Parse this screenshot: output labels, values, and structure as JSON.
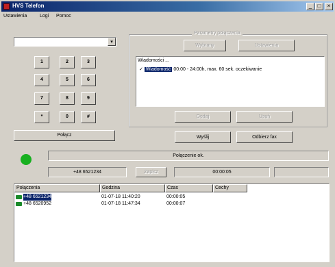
{
  "window": {
    "title": "HVS Telefon"
  },
  "menu": [
    {
      "label": "Ustawienia"
    },
    {
      "label": "Logi"
    },
    {
      "label": "Pomoc"
    }
  ],
  "dial": {
    "combo_value": "",
    "keys": [
      "1",
      "2",
      "3",
      "4",
      "5",
      "6",
      "7",
      "8",
      "9",
      "*",
      "0",
      "#"
    ],
    "connect_label": "Połącz"
  },
  "connection_group": {
    "legend": "Parametry połączenia",
    "tabs": [
      "Wybrany",
      "Ustawienia"
    ],
    "list_header": "Wiadomości ...",
    "list_item_selected": "Wiadomość",
    "list_item_detail": "00:00 - 24:00h, max. 60 sek. oczekiwanie",
    "buttons": [
      "Dodaj",
      "Usuń"
    ]
  },
  "actions": {
    "send": "Wyślij",
    "fax": "Odbierz fax"
  },
  "status": {
    "led_color": "#18b020",
    "message": "Połączenie ok.",
    "number": "+48 6521234",
    "code": "Zapisz",
    "timer": "00:00:05",
    "extra": ""
  },
  "log_table": {
    "columns": [
      "Połączenia",
      "Godzina",
      "Czas",
      "Cechy"
    ],
    "rows": [
      {
        "number": "+48 6521234",
        "time": "01-07-18 11:40:20",
        "duration": "00:00:05",
        "features": "",
        "selected": true
      },
      {
        "number": "+48 6520952",
        "time": "01-07-18 11:47:34",
        "duration": "00:00:07",
        "features": "",
        "selected": false
      }
    ]
  }
}
